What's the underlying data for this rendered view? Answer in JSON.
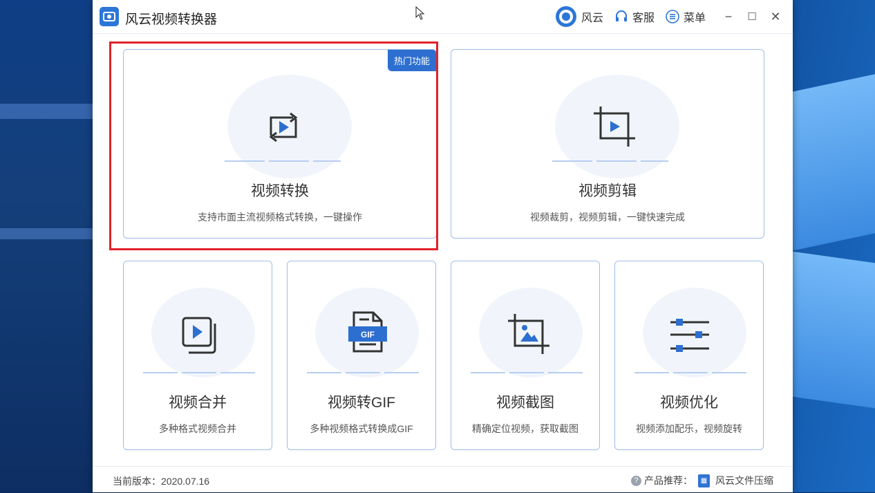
{
  "window": {
    "title": "风云视频转换器",
    "header_links": [
      {
        "label": "风云",
        "icon": "fengyun-logo-icon"
      },
      {
        "label": "客服",
        "icon": "headset-icon"
      },
      {
        "label": "菜单",
        "icon": "menu-list-icon"
      }
    ],
    "controls": {
      "minimize": "−",
      "maximize": "☐",
      "close": "✕"
    }
  },
  "features": [
    {
      "id": "convert",
      "name": "视频转换",
      "desc": "支持市面主流视频格式转换，一键操作",
      "icon": "video-convert-icon",
      "badge": "热门功能"
    },
    {
      "id": "edit",
      "name": "视频剪辑",
      "desc": "视频裁剪，视频剪辑，一键快速完成",
      "icon": "video-crop-icon"
    },
    {
      "id": "merge",
      "name": "视频合并",
      "desc": "多种格式视频合并",
      "icon": "video-merge-icon"
    },
    {
      "id": "gif",
      "name": "视频转GIF",
      "desc": "多种视频格式转换成GIF",
      "icon": "gif-file-icon",
      "icon_text": "GIF"
    },
    {
      "id": "screenshot",
      "name": "视频截图",
      "desc": "精确定位视频，获取截图",
      "icon": "image-crop-icon"
    },
    {
      "id": "optimize",
      "name": "视频优化",
      "desc": "视频添加配乐，视频旋转",
      "icon": "sliders-icon"
    }
  ],
  "footer": {
    "version_label": "当前版本：2020.07.16",
    "recommend_label": "产品推荐：",
    "recommend_product": "风云文件压缩",
    "help_glyph": "?"
  },
  "colors": {
    "accent": "#2d6fd0",
    "highlight": "#e0222a",
    "card_border": "#9dbde8"
  }
}
